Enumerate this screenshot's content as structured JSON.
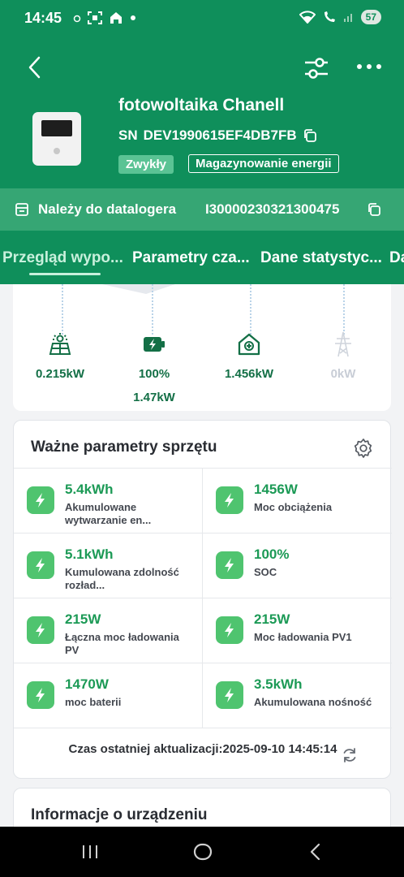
{
  "status_bar": {
    "time": "14:45",
    "battery": "57"
  },
  "device": {
    "name": "fotowoltaika Chanell",
    "sn_prefix": "SN",
    "sn": "DEV1990615EF4DB7FB",
    "type_tag": "Zwykły",
    "role_tag": "Magazynowanie energii"
  },
  "datalogger": {
    "label": "Należy do datalogera",
    "value": "I30000230321300475"
  },
  "tabs": [
    {
      "label": "Przegląd wypo..."
    },
    {
      "label": "Parametry cza..."
    },
    {
      "label": "Dane statystyc..."
    },
    {
      "label": "Da"
    }
  ],
  "flow": {
    "pv": {
      "value": "0.215kW",
      "icon": "solar-panel-icon"
    },
    "battery": {
      "value": "100%",
      "value2": "1.47kW",
      "icon": "battery-charging-icon"
    },
    "home": {
      "value": "1.456kW",
      "icon": "home-icon"
    },
    "grid": {
      "value": "0kW",
      "icon": "power-tower-icon"
    }
  },
  "params": {
    "title": "Ważne parametry sprzętu",
    "items": [
      {
        "value": "5.4kWh",
        "label": "Akumulowane wytwarzanie en..."
      },
      {
        "value": "1456W",
        "label": "Moc obciążenia"
      },
      {
        "value": "5.1kWh",
        "label": "Kumulowana zdolność rozład..."
      },
      {
        "value": "100%",
        "label": "SOC"
      },
      {
        "value": "215W",
        "label": "Łączna moc ładowania PV"
      },
      {
        "value": "215W",
        "label": "Moc ładowania PV1"
      },
      {
        "value": "1470W",
        "label": "moc baterii"
      },
      {
        "value": "3.5kWh",
        "label": "Akumulowana nośność"
      }
    ],
    "last_update": "Czas ostatniej aktualizacji:2025-09-10 14:45:14"
  },
  "info": {
    "title": "Informacje o urządzeniu"
  },
  "colors": {
    "header": "#0f8f5b",
    "accent": "#1c9a56",
    "icon_bg": "#4fc46f"
  }
}
